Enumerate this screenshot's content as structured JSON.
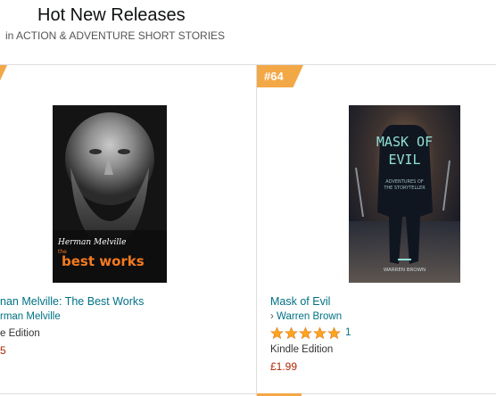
{
  "header": {
    "title": "Hot New Releases",
    "subtitle": "in ACTION & ADVENTURE SHORT STORIES"
  },
  "items": [
    {
      "rank": "",
      "title": "nan Melville: The Best Works",
      "author": "rman Melville",
      "format": "e Edition",
      "price": "5",
      "cover": {
        "author_line": "Herman Melville",
        "the": "the",
        "best_works": "best works"
      }
    },
    {
      "rank": "#64",
      "title": "Mask of Evil",
      "author": "Warren Brown",
      "author_prefix": "›",
      "rating": 5,
      "rating_count": "1",
      "format": "Kindle Edition",
      "price": "£1.99",
      "cover": {
        "title_line1": "MASK OF",
        "title_line2": "EVIL",
        "subtitle_line1": "ADVENTURES OF",
        "subtitle_line2": "THE STORYTELLER",
        "author_line": "WARREN BROWN"
      }
    }
  ],
  "colors": {
    "link": "#007185",
    "price": "#b12704",
    "badge": "#f3a847",
    "star": "#ffa41c"
  }
}
